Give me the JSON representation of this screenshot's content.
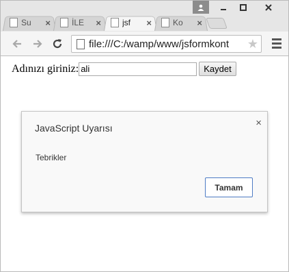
{
  "tabs": [
    {
      "label": "Su",
      "active": false
    },
    {
      "label": "İLE",
      "active": false
    },
    {
      "label": "jsf",
      "active": true
    },
    {
      "label": "Ko",
      "active": false
    }
  ],
  "toolbar": {
    "url": "file:///C:/wamp/www/jsformkont"
  },
  "page": {
    "form_label": "Adınızı giriniz:",
    "name_value": "ali",
    "submit_label": "Kaydet"
  },
  "dialog": {
    "title": "JavaScript Uyarısı",
    "message": "Tebrikler",
    "ok_label": "Tamam",
    "close_glyph": "×"
  }
}
